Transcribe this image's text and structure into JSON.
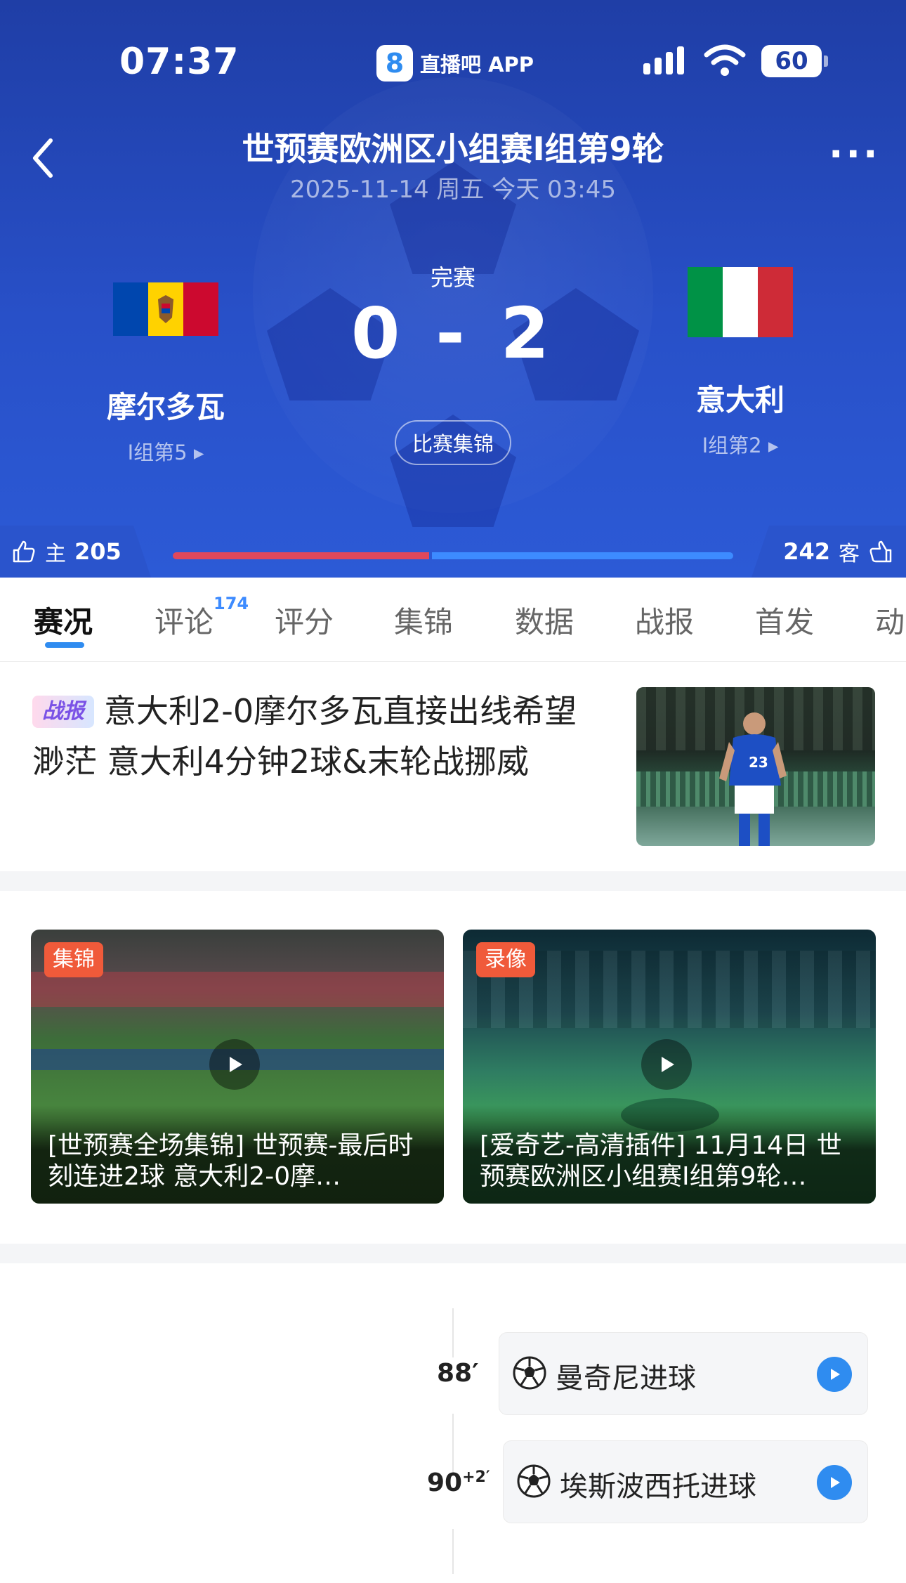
{
  "status_bar": {
    "time": "07:37",
    "app_logo": "8",
    "app_name": "直播吧 APP",
    "battery": "60"
  },
  "match": {
    "title": "世预赛欧洲区小组赛I组第9轮",
    "datetime": "2025-11-14 周五 今天 03:45",
    "status": "完赛",
    "score": "0 - 2",
    "highlights_button": "比赛集锦",
    "home": {
      "name": "摩尔多瓦",
      "rank": "I组第5 ▸",
      "flag_colors": [
        "#0046ae",
        "#ffd200",
        "#cc092f"
      ]
    },
    "away": {
      "name": "意大利",
      "rank": "I组第2 ▸",
      "flag_colors": [
        "#009246",
        "#ffffff",
        "#ce2b37"
      ]
    }
  },
  "votes": {
    "home_label": "主",
    "home_count": "205",
    "away_label": "客",
    "away_count": "242",
    "home_fraction": 0.46
  },
  "tabs": [
    {
      "label": "赛况",
      "active": true
    },
    {
      "label": "评论",
      "badge": "174"
    },
    {
      "label": "评分"
    },
    {
      "label": "集锦"
    },
    {
      "label": "数据"
    },
    {
      "label": "战报"
    },
    {
      "label": "首发"
    },
    {
      "label": "动"
    }
  ],
  "news": {
    "badge": "战报",
    "headline": "意大利2-0摩尔多瓦直接出线希望渺茫 意大利4分钟2球&末轮战挪威"
  },
  "videos": [
    {
      "tag": "集锦",
      "caption": "[世预赛全场集锦] 世预赛-最后时刻连进2球 意大利2-0摩…"
    },
    {
      "tag": "录像",
      "caption": "[爱奇艺-高清插件] 11月14日 世预赛欧洲区小组赛I组第9轮…"
    }
  ],
  "timeline": [
    {
      "minute": "88′",
      "extra": "",
      "event": "曼奇尼进球"
    },
    {
      "minute": "90",
      "extra": "+2′",
      "event": "埃斯波西托进球"
    }
  ],
  "colors": {
    "accent": "#2f8cf0",
    "header": "#2850c8",
    "home_bar": "#e0485b",
    "away_bar": "#3d8bff",
    "tag": "#f05a3a"
  },
  "icons": {
    "back": "chevron-left-icon",
    "more": "more-dots-icon",
    "thumb": "thumbs-up-icon",
    "goal": "soccer-ball-icon",
    "play": "play-icon"
  }
}
